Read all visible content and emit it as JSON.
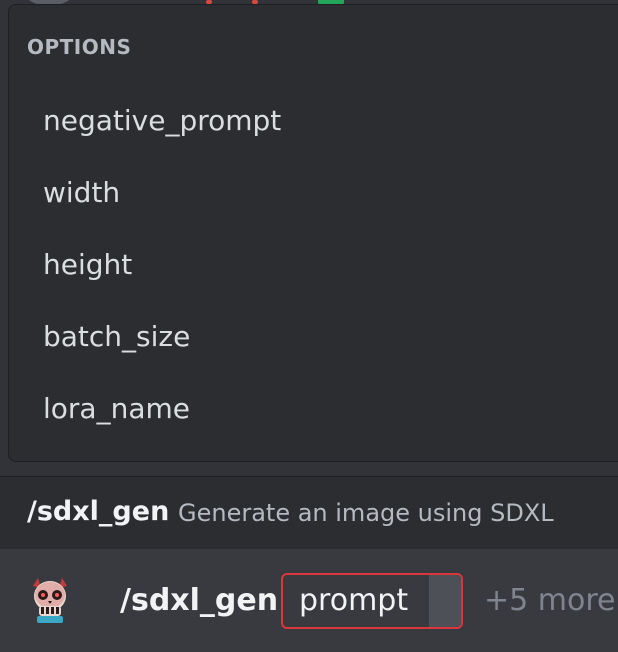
{
  "options": {
    "header": "OPTIONS",
    "items": [
      {
        "label": "negative_prompt"
      },
      {
        "label": "width"
      },
      {
        "label": "height"
      },
      {
        "label": "batch_size"
      },
      {
        "label": "lora_name"
      }
    ]
  },
  "command_suggestion": {
    "name": "/sdxl_gen",
    "description": "Generate an image using SDXL"
  },
  "input": {
    "command": "/sdxl_gen",
    "param_label": "prompt",
    "more_label": "+5 more",
    "avatar_icon": "demon-skull-avatar-icon"
  },
  "colors": {
    "background": "#313338",
    "popup": "#2b2d31",
    "input_row": "#383a40",
    "pill_border": "#da373c",
    "text_primary": "#f2f3f5",
    "text_muted": "#b5bac1"
  }
}
